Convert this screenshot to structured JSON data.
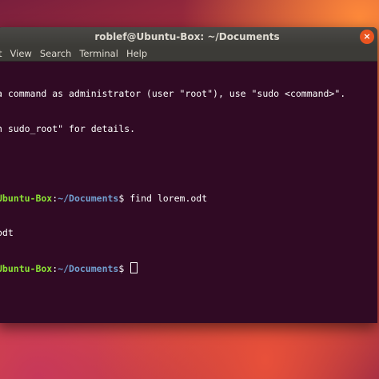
{
  "window": {
    "title": "roblef@Ubuntu-Box: ~/Documents",
    "close_glyph": "×"
  },
  "menu": {
    "items": [
      "t",
      "View",
      "Search",
      "Terminal",
      "Help"
    ]
  },
  "terminal": {
    "lines": [
      "a command as administrator (user \"root\"), use \"sudo <command>\".",
      "n sudo_root\" for details."
    ],
    "prompt1": {
      "user": "Ubuntu-Box",
      "colon": ":",
      "path": "~/Documents",
      "dollar": "$ ",
      "command": "find lorem.odt"
    },
    "output": "odt",
    "prompt2": {
      "user": "Ubuntu-Box",
      "colon": ":",
      "path": "~/Documents",
      "dollar": "$ "
    }
  },
  "colors": {
    "terminal_bg": "#300a24",
    "prompt_user": "#8ae234",
    "prompt_path": "#729fcf",
    "close_button": "#e95420"
  }
}
